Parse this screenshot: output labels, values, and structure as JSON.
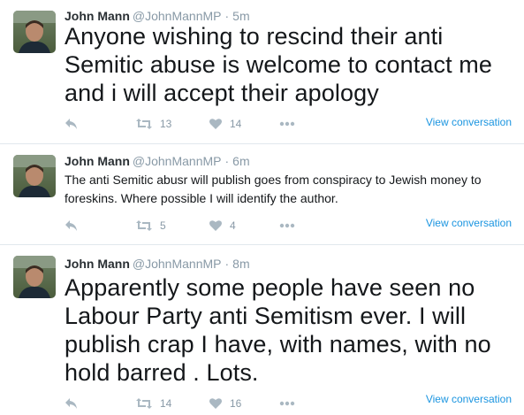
{
  "tweets": [
    {
      "fullname": "John Mann",
      "username": "@JohnMannMP",
      "dot": "·",
      "time": "5m",
      "text": "Anyone wishing to rescind their anti Semitic abuse is welcome to contact me and i will accept their apology",
      "retweets": "13",
      "likes": "14",
      "view_conversation": "View conversation"
    },
    {
      "fullname": "John Mann",
      "username": "@JohnMannMP",
      "dot": "·",
      "time": "6m",
      "text": "The anti Semitic abusr will publish goes from conspiracy to Jewish money to foreskins. Where possible I will identify the author.",
      "retweets": "5",
      "likes": "4",
      "view_conversation": "View conversation"
    },
    {
      "fullname": "John Mann",
      "username": "@JohnMannMP",
      "dot": "·",
      "time": "8m",
      "text": "Apparently some people have seen no Labour Party anti Semitism ever. I will publish crap I have, with names, with no hold barred . Lots.",
      "retweets": "14",
      "likes": "16",
      "view_conversation": "View conversation"
    }
  ],
  "icons": {
    "reply": "reply-icon",
    "retweet": "retweet-icon",
    "like": "heart-icon",
    "more": "more-icon"
  },
  "colors": {
    "link": "#1b95e0",
    "muted": "#8899a6",
    "icon": "#aab8c2",
    "divider": "#e1e8ed"
  }
}
